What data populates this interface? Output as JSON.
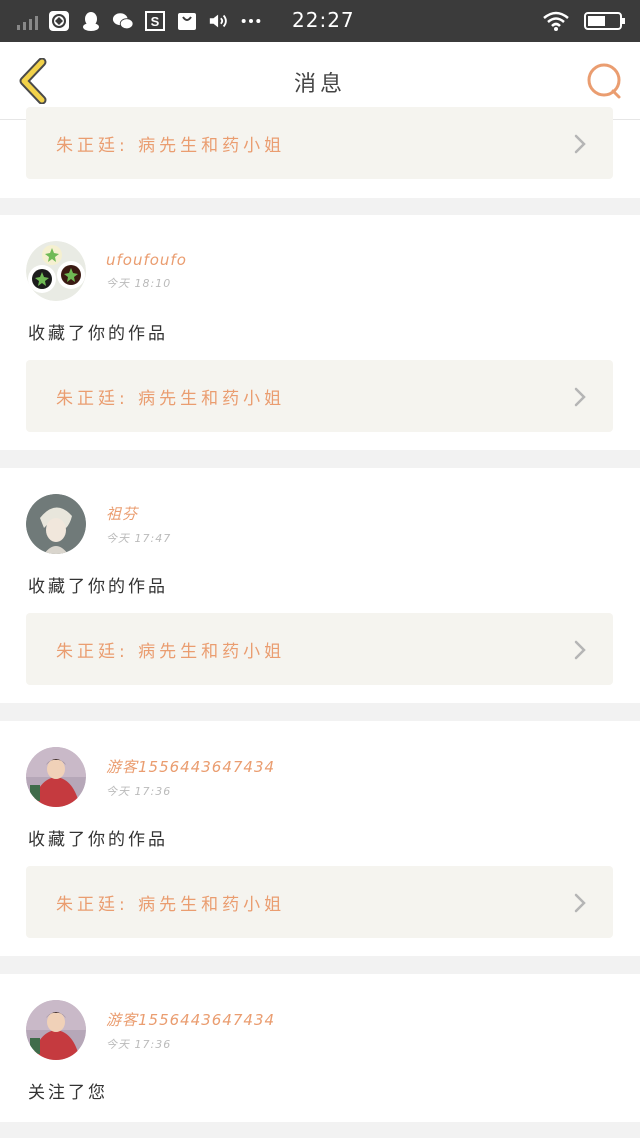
{
  "status_bar": {
    "time": "22:27",
    "left_icons": [
      "signal-bars-icon",
      "browser-icon",
      "qq-icon",
      "wechat-icon",
      "s-app-icon",
      "shopping-bag-icon",
      "volume-icon",
      "more-dots-icon"
    ],
    "right_icons": [
      "wifi-icon",
      "battery-icon"
    ]
  },
  "header": {
    "title": "消息"
  },
  "colors": {
    "accent": "#ea9d70",
    "back_arrow": "#f2d24a",
    "card_link_bg": "#f5f4ef",
    "status_bar_bg": "#3b3b3b"
  },
  "messages": [
    {
      "work_title": "朱正廷: 病先生和药小姐"
    },
    {
      "username": "ufoufoufo",
      "timestamp": "今天 18:10",
      "action": "收藏了你的作品",
      "work_title": "朱正廷: 病先生和药小姐"
    },
    {
      "username": "祖芬",
      "timestamp": "今天 17:47",
      "action": "收藏了你的作品",
      "work_title": "朱正廷: 病先生和药小姐"
    },
    {
      "username": "游客1556443647434",
      "timestamp": "今天 17:36",
      "action": "收藏了你的作品",
      "work_title": "朱正廷: 病先生和药小姐"
    },
    {
      "username": "游客1556443647434",
      "timestamp": "今天 17:36",
      "action": "关注了您"
    }
  ]
}
